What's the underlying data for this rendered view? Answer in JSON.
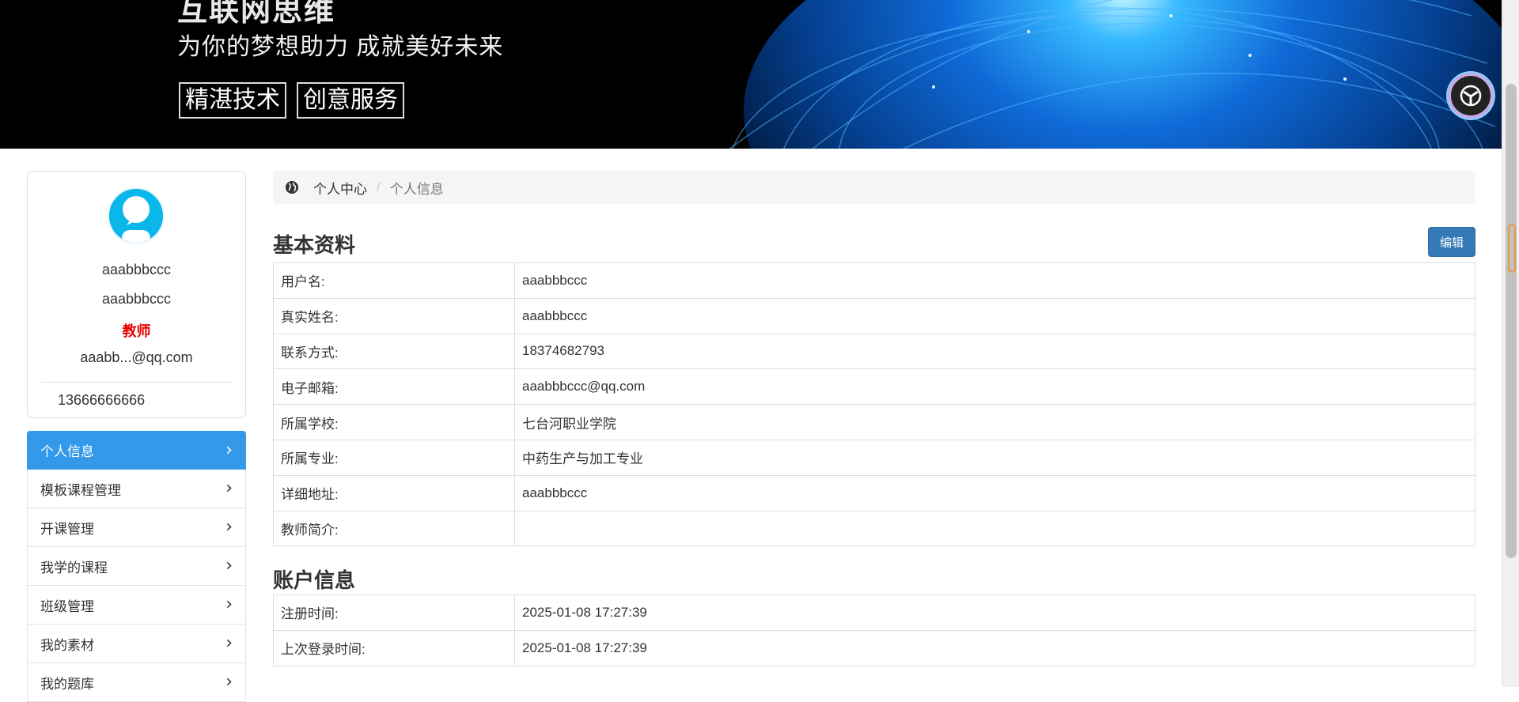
{
  "banner": {
    "title_partial": "互联网思维",
    "slogan": "为你的梦想助力  成就美好未来",
    "tags": [
      "精湛技术",
      "创意服务"
    ]
  },
  "profile": {
    "username": "aaabbbccc",
    "realname": "aaabbbccc",
    "role": "教师",
    "email_short": "aaabb...@qq.com",
    "phone": "13666666666"
  },
  "menu": {
    "items": [
      {
        "label": "个人信息"
      },
      {
        "label": "模板课程管理"
      },
      {
        "label": "开课管理"
      },
      {
        "label": "我学的课程"
      },
      {
        "label": "班级管理"
      },
      {
        "label": "我的素材"
      },
      {
        "label": "我的题库"
      }
    ]
  },
  "breadcrumb": {
    "home": "个人中心",
    "separator": "/",
    "current": "个人信息"
  },
  "basic": {
    "title": "基本资料",
    "edit_label": "编辑",
    "rows": [
      {
        "label": "用户名:",
        "value": "aaabbbccc"
      },
      {
        "label": "真实姓名:",
        "value": "aaabbbccc"
      },
      {
        "label": "联系方式:",
        "value": "18374682793"
      },
      {
        "label": "电子邮箱:",
        "value": "aaabbbccc@qq.com"
      },
      {
        "label": "所属学校:",
        "value": "七台河职业学院"
      },
      {
        "label": "所属专业:",
        "value": "中药生产与加工专业"
      },
      {
        "label": "详细地址:",
        "value": "aaabbbccc"
      },
      {
        "label": "教师简介:",
        "value": ""
      }
    ]
  },
  "account": {
    "title": "账户信息",
    "rows": [
      {
        "label": "注册时间:",
        "value": "2025-01-08 17:27:39"
      },
      {
        "label": "上次登录时间:",
        "value": "2025-01-08 17:27:39"
      }
    ]
  },
  "colors": {
    "accent": "#3399e8",
    "button": "#337ab7",
    "role_text": "#e60000",
    "avatar_bg": "#0ab7ea"
  }
}
